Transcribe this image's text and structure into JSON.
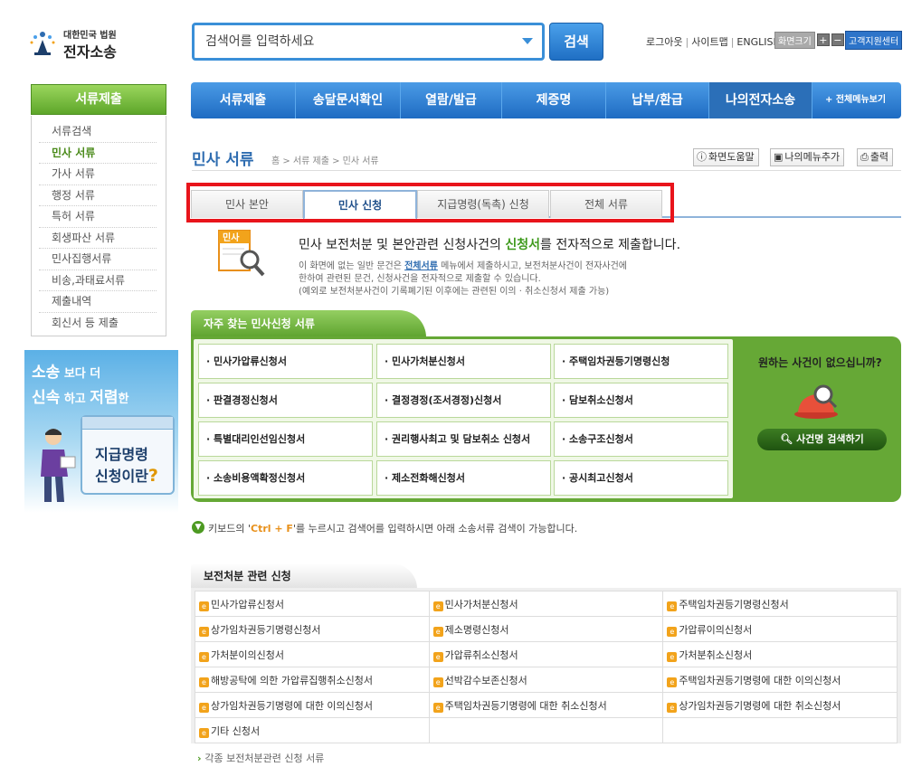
{
  "logo": {
    "top": "대한민국 법원",
    "bottom": "전자소송"
  },
  "search": {
    "placeholder": "검색어를 입력하세요",
    "button": "검색"
  },
  "top_links": [
    "로그아웃",
    "사이트맵",
    "ENGLISH"
  ],
  "font_size": {
    "label": "화면크기",
    "plus": "+",
    "minus": "−"
  },
  "customer_center": "고객지원센터",
  "main_nav": {
    "items": [
      "서류제출",
      "송달문서확인",
      "열람/발급",
      "제증명",
      "납부/환급",
      "나의전자소송"
    ],
    "all_menu": "+ 전체메뉴보기",
    "active_index": 5
  },
  "sidebar": {
    "title": "서류제출",
    "items": [
      "서류검색",
      "민사 서류",
      "가사 서류",
      "행정 서류",
      "특허 서류",
      "회생파산 서류",
      "민사집행서류",
      "비송,과태료서류",
      "제출내역",
      "회신서 등 제출"
    ],
    "active_index": 1
  },
  "banner": {
    "line1_a": "소송",
    "line1_b": "보다 더",
    "line2_a": "신속",
    "line2_b": "하고",
    "line2_c": "저렴",
    "line2_d": "한",
    "cal_line1": "지급명령",
    "cal_line2": "신청이란",
    "cal_q": "?"
  },
  "page": {
    "title": "민사 서류",
    "breadcrumb": "홈 > 서류 제출 > 민사 서류"
  },
  "util_buttons": [
    "화면도움말",
    "나의메뉴추가",
    "출력"
  ],
  "tabs": {
    "items": [
      "민사 본안",
      "민사 신청",
      "지급명령(독촉) 신청",
      "전체 서류"
    ],
    "active_index": 1
  },
  "intro": {
    "icon_label": "민사",
    "head_a": "민사 보전처분 및 본안관련 신청사건의 ",
    "head_hl": "신청서",
    "head_b": "를 전자적으로 제출합니다.",
    "body1_a": "이 화면에 없는 일반 문건은 ",
    "body1_link": "전체서류",
    "body1_b": " 메뉴에서 제출하시고, 보전처분사건이 전자사건에",
    "body2": "한하여 관련된 문건, 신청사건을 전자적으로 제출할 수 있습니다.",
    "body3": "(예외로 보전처분사건이 기록폐기된 이후에는 관련된 이의 · 취소신청서 제출 가능)"
  },
  "frequent": {
    "title": "자주 찾는 민사신청 서류",
    "items": [
      "· 민사가압류신청서",
      "· 민사가처분신청서",
      "· 주택임차권등기명령신청",
      "· 판결경정신청서",
      "· 결정경정(조서경정)신청서",
      "· 담보취소신청서",
      "· 특별대리인선임신청서",
      "· 권리행사최고 및 담보취소 신청서",
      "· 소송구조신청서",
      "· 소송비용액확정신청서",
      "· 제소전화해신청서",
      "· 공시최고신청서"
    ],
    "side_title": "원하는 사건이 없으십니까?",
    "side_button": "사건명 검색하기"
  },
  "hint": {
    "a": "키보드의 '",
    "key": "Ctrl + F",
    "b": "'를 누르시고 검색어를 입력하시면 아래 소송서류 검색이 가능합니다."
  },
  "related": {
    "title": "보전처분 관련 신청",
    "rows": [
      [
        "민사가압류신청서",
        "민사가처분신청서",
        "주택임차권등기명령신청서"
      ],
      [
        "상가임차권등기명령신청서",
        "제소명령신청서",
        "가압류이의신청서"
      ],
      [
        "가처분이의신청서",
        "가압류취소신청서",
        "가처분취소신청서"
      ],
      [
        "해방공탁에 의한 가압류집행취소신청서",
        "선박감수보존신청서",
        "주택임차권등기명령에 대한 이의신청서"
      ],
      [
        "상가임차권등기명령에 대한 이의신청서",
        "주택임차권등기명령에 대한 취소신청서",
        "상가임차권등기명령에 대한 취소신청서"
      ],
      [
        "기타 신청서",
        "",
        ""
      ]
    ],
    "more": "각종 보전처분관련 신청 서류"
  },
  "colors": {
    "primary_blue": "#2e6cb0",
    "nav_blue": "#1e6bc2",
    "green": "#66a836",
    "highlight_red": "#e8141b",
    "doc_icon": "#f2a31b"
  }
}
